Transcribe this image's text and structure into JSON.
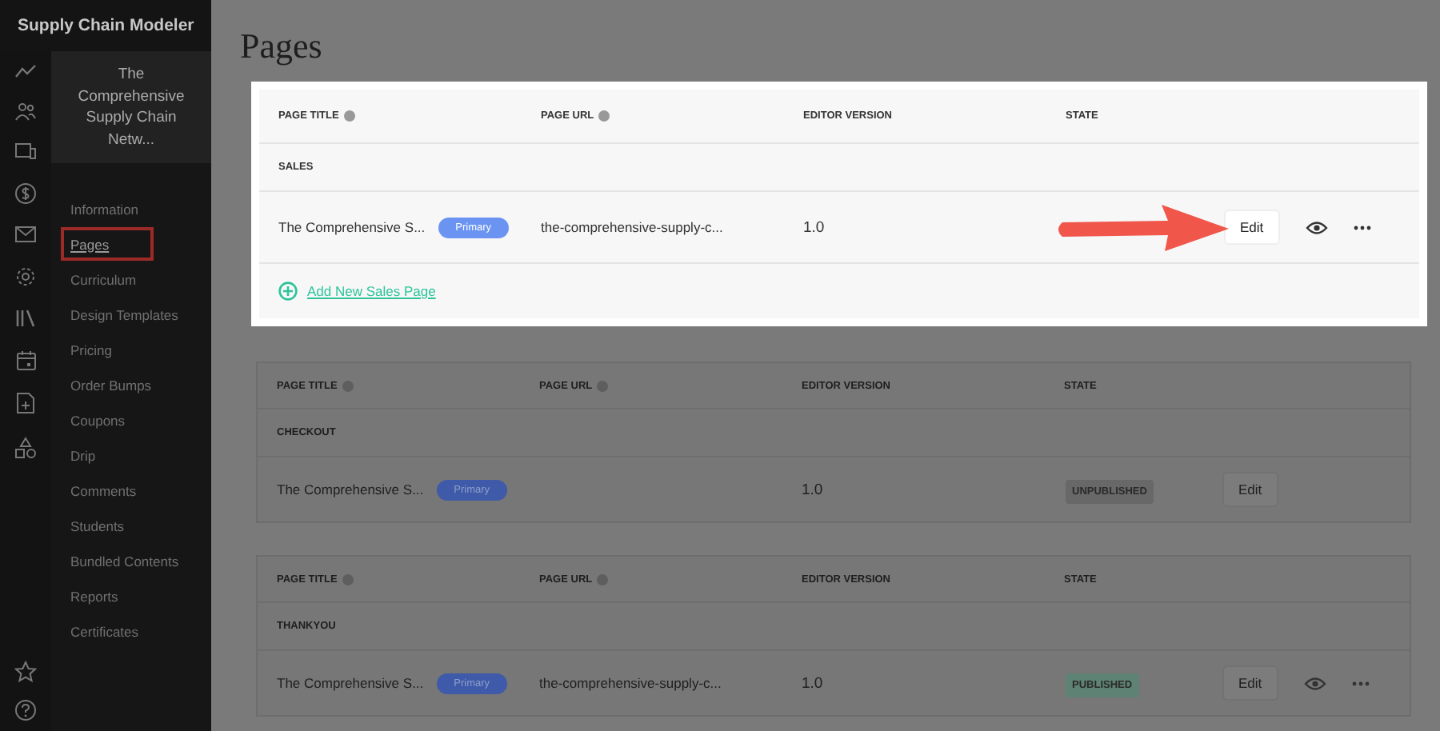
{
  "app_title": "Supply Chain Modeler",
  "course_title": "The Comprehensive Supply Chain Netw...",
  "nav": [
    {
      "label": "Information",
      "selected": false
    },
    {
      "label": "Pages",
      "selected": true
    },
    {
      "label": "Curriculum",
      "selected": false
    },
    {
      "label": "Design Templates",
      "selected": false
    },
    {
      "label": "Pricing",
      "selected": false
    },
    {
      "label": "Order Bumps",
      "selected": false
    },
    {
      "label": "Coupons",
      "selected": false
    },
    {
      "label": "Drip",
      "selected": false
    },
    {
      "label": "Comments",
      "selected": false
    },
    {
      "label": "Students",
      "selected": false
    },
    {
      "label": "Bundled Contents",
      "selected": false
    },
    {
      "label": "Reports",
      "selected": false
    },
    {
      "label": "Certificates",
      "selected": false
    }
  ],
  "page_title": "Pages",
  "sections": [
    {
      "highlighted": true,
      "columns": [
        "PAGE TITLE",
        "PAGE URL",
        "EDITOR VERSION",
        "STATE"
      ],
      "name": "SALES",
      "rows": [
        {
          "title": "The Comprehensive S...",
          "badge": "Primary",
          "url": "the-comprehensive-supply-c...",
          "version": "1.0",
          "edit": "Edit",
          "preview": true,
          "more": true,
          "arrow": true
        }
      ],
      "add_link": "Add New Sales Page"
    },
    {
      "highlighted": false,
      "columns": [
        "PAGE TITLE",
        "PAGE URL",
        "EDITOR VERSION",
        "STATE"
      ],
      "name": "CHECKOUT",
      "rows": [
        {
          "title": "The Comprehensive S...",
          "badge": "Primary",
          "version": "1.0",
          "state": {
            "label": "UNPUBLISHED",
            "kind": "unpublished"
          },
          "edit": "Edit",
          "preview": false,
          "more": false,
          "arrow": false
        }
      ]
    },
    {
      "highlighted": false,
      "columns": [
        "PAGE TITLE",
        "PAGE URL",
        "EDITOR VERSION",
        "STATE"
      ],
      "name": "THANKYOU",
      "rows": [
        {
          "title": "The Comprehensive S...",
          "badge": "Primary",
          "url": "the-comprehensive-supply-c...",
          "version": "1.0",
          "state": {
            "label": "PUBLISHED",
            "kind": "published"
          },
          "edit": "Edit",
          "preview": true,
          "more": true,
          "arrow": false
        }
      ]
    }
  ]
}
